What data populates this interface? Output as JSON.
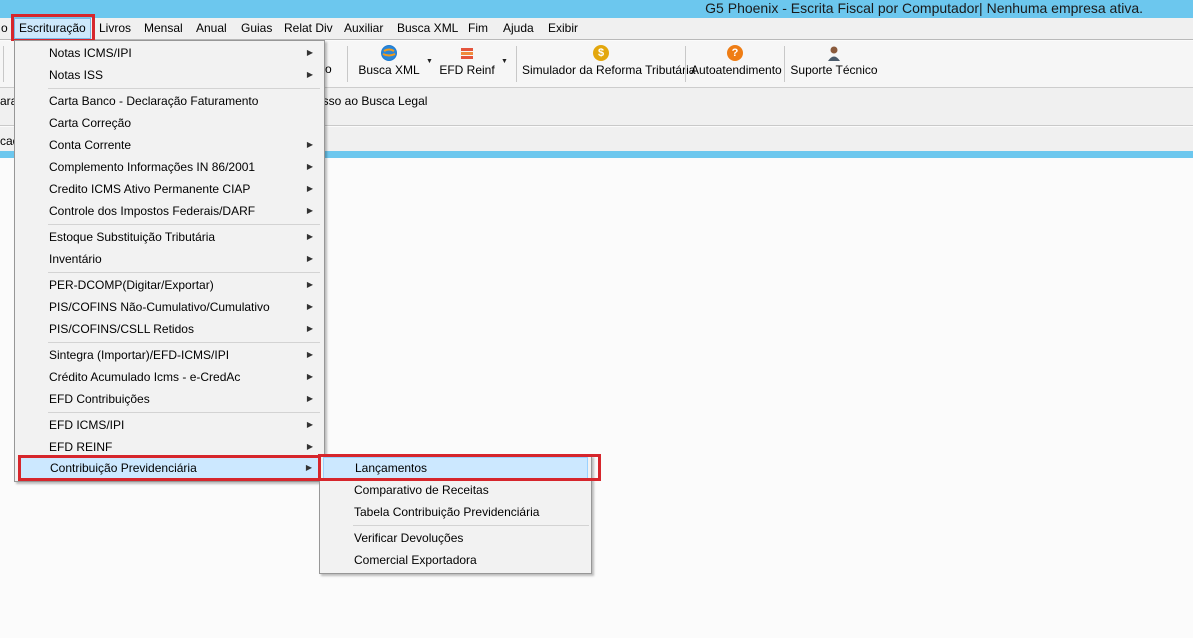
{
  "window": {
    "title": "G5 Phoenix - Escrita Fiscal por Computador| Nenhuma empresa ativa."
  },
  "menubar": {
    "items": [
      {
        "label": "o"
      },
      {
        "label": "Escrituração"
      },
      {
        "label": "Livros"
      },
      {
        "label": "Mensal"
      },
      {
        "label": "Anual"
      },
      {
        "label": "Guias"
      },
      {
        "label": "Relat Div"
      },
      {
        "label": "Auxiliar"
      },
      {
        "label": "Busca XML"
      },
      {
        "label": "Fim"
      },
      {
        "label": "Ajuda"
      },
      {
        "label": "Exibir"
      }
    ]
  },
  "toolbar": {
    "partial_label": "o",
    "busca_xml": "Busca XML",
    "efd_reinf": "EFD Reinf",
    "simulador": "Simulador da Reforma Tributária",
    "autoatendimento": "Autoatendimento",
    "suporte": "Suporte Técnico",
    "dollar_glyph": "$",
    "help_glyph": "?"
  },
  "bar2": {
    "left": "ara",
    "right": "esso ao Busca Legal"
  },
  "bar3": {
    "left": "cad"
  },
  "escrituracao_menu": {
    "items": [
      {
        "label": "Notas ICMS/IPI"
      },
      {
        "label": "Notas ISS"
      },
      {
        "label": "Carta Banco - Declaração Faturamento"
      },
      {
        "label": "Carta Correção"
      },
      {
        "label": "Conta Corrente"
      },
      {
        "label": "Complemento Informações IN 86/2001"
      },
      {
        "label": "Credito ICMS Ativo Permanente CIAP"
      },
      {
        "label": "Controle dos Impostos Federais/DARF"
      },
      {
        "label": "Estoque Substituição Tributária"
      },
      {
        "label": "Inventário"
      },
      {
        "label": "PER-DCOMP(Digitar/Exportar)"
      },
      {
        "label": "PIS/COFINS Não-Cumulativo/Cumulativo"
      },
      {
        "label": "PIS/COFINS/CSLL Retidos"
      },
      {
        "label": "Sintegra (Importar)/EFD-ICMS/IPI"
      },
      {
        "label": "Crédito Acumulado Icms - e-CredAc"
      },
      {
        "label": "EFD Contribuições"
      },
      {
        "label": "EFD ICMS/IPI"
      },
      {
        "label": "EFD REINF"
      },
      {
        "label": "Contribuição Previdenciária"
      }
    ]
  },
  "contribuicao_submenu": {
    "items": [
      {
        "label": "Lançamentos"
      },
      {
        "label": "Comparativo de Receitas"
      },
      {
        "label": "Tabela Contribuição Previdenciária"
      },
      {
        "label": "Verificar Devoluções"
      },
      {
        "label": "Comercial Exportadora"
      }
    ]
  },
  "colors": {
    "titlebar": "#6cc7ee",
    "highlight": "#cce8ff",
    "annotation_red": "#d6262c"
  }
}
